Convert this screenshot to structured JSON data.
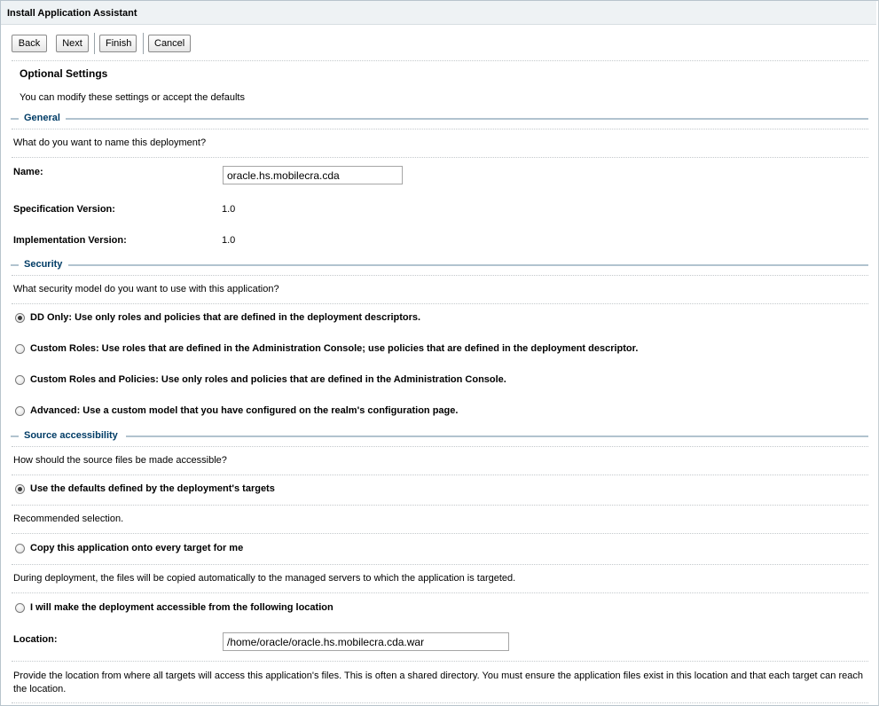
{
  "window": {
    "title": "Install Application Assistant"
  },
  "toolbar": {
    "back": "Back",
    "next": "Next",
    "finish": "Finish",
    "cancel": "Cancel"
  },
  "page": {
    "heading": "Optional Settings",
    "subheading": "You can modify these settings or accept the defaults"
  },
  "general": {
    "title": "General",
    "question": "What do you want to name this deployment?",
    "name_label": "Name:",
    "name_value": "oracle.hs.mobilecra.cda",
    "spec_label": "Specification Version:",
    "spec_value": "1.0",
    "impl_label": "Implementation Version:",
    "impl_value": "1.0"
  },
  "security": {
    "title": "Security",
    "question": "What security model do you want to use with this application?",
    "options": [
      {
        "label": "DD Only: Use only roles and policies that are defined in the deployment descriptors.",
        "selected": true
      },
      {
        "label": "Custom Roles: Use roles that are defined in the Administration Console; use policies that are defined in the deployment descriptor.",
        "selected": false
      },
      {
        "label": "Custom Roles and Policies: Use only roles and policies that are defined in the Administration Console.",
        "selected": false
      },
      {
        "label": "Advanced: Use a custom model that you have configured on the realm's configuration page.",
        "selected": false
      }
    ]
  },
  "source": {
    "title": "Source accessibility",
    "question": "How should the source files be made accessible?",
    "options": [
      {
        "label": "Use the defaults defined by the deployment's targets",
        "selected": true,
        "note": "Recommended selection."
      },
      {
        "label": "Copy this application onto every target for me",
        "selected": false,
        "note": "During deployment, the files will be copied automatically to the managed servers to which the application is targeted."
      },
      {
        "label": "I will make the deployment accessible from the following location",
        "selected": false,
        "note": ""
      }
    ],
    "location_label": "Location:",
    "location_value": "/home/oracle/oracle.hs.mobilecra.cda.war",
    "location_note": "Provide the location from where all targets will access this application's files. This is often a shared directory. You must ensure the application files exist in this location and that each target can reach the location."
  }
}
